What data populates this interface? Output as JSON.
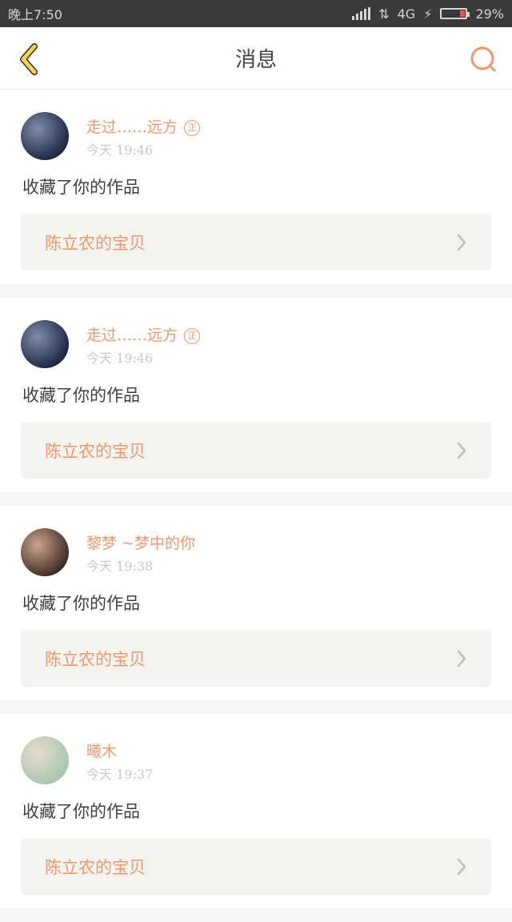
{
  "status_bar": {
    "time": "晚上7:50",
    "network": "4G",
    "battery": "29%",
    "battery_level": 0.29
  },
  "header": {
    "title": "消息",
    "back_icon": "chevron-left-icon",
    "search_icon": "search-icon"
  },
  "colors": {
    "accent": "#f0976a",
    "back_icon": "#f2d34a",
    "link_bg": "#f3f3ef"
  },
  "messages": [
    {
      "username": "走过……远方",
      "badge": "正",
      "time": "今天 19:46",
      "action": "收藏了你的作品",
      "link": "陈立农的宝贝",
      "avatar_colors": [
        "#1a2540",
        "#7f8eaa"
      ]
    },
    {
      "username": "走过……远方",
      "badge": "正",
      "time": "今天 19:46",
      "action": "收藏了你的作品",
      "link": "陈立农的宝贝",
      "avatar_colors": [
        "#1a2540",
        "#7f8eaa"
      ]
    },
    {
      "username": "黎梦 ~梦中的你",
      "badge": "",
      "time": "今天 19:38",
      "action": "收藏了你的作品",
      "link": "陈立农的宝贝",
      "avatar_colors": [
        "#3b2a22",
        "#cfa58f"
      ]
    },
    {
      "username": "曦木",
      "badge": "",
      "time": "今天 19:37",
      "action": "收藏了你的作品",
      "link": "陈立农的宝贝",
      "avatar_colors": [
        "#a7c6ad",
        "#e8dccd"
      ]
    }
  ]
}
